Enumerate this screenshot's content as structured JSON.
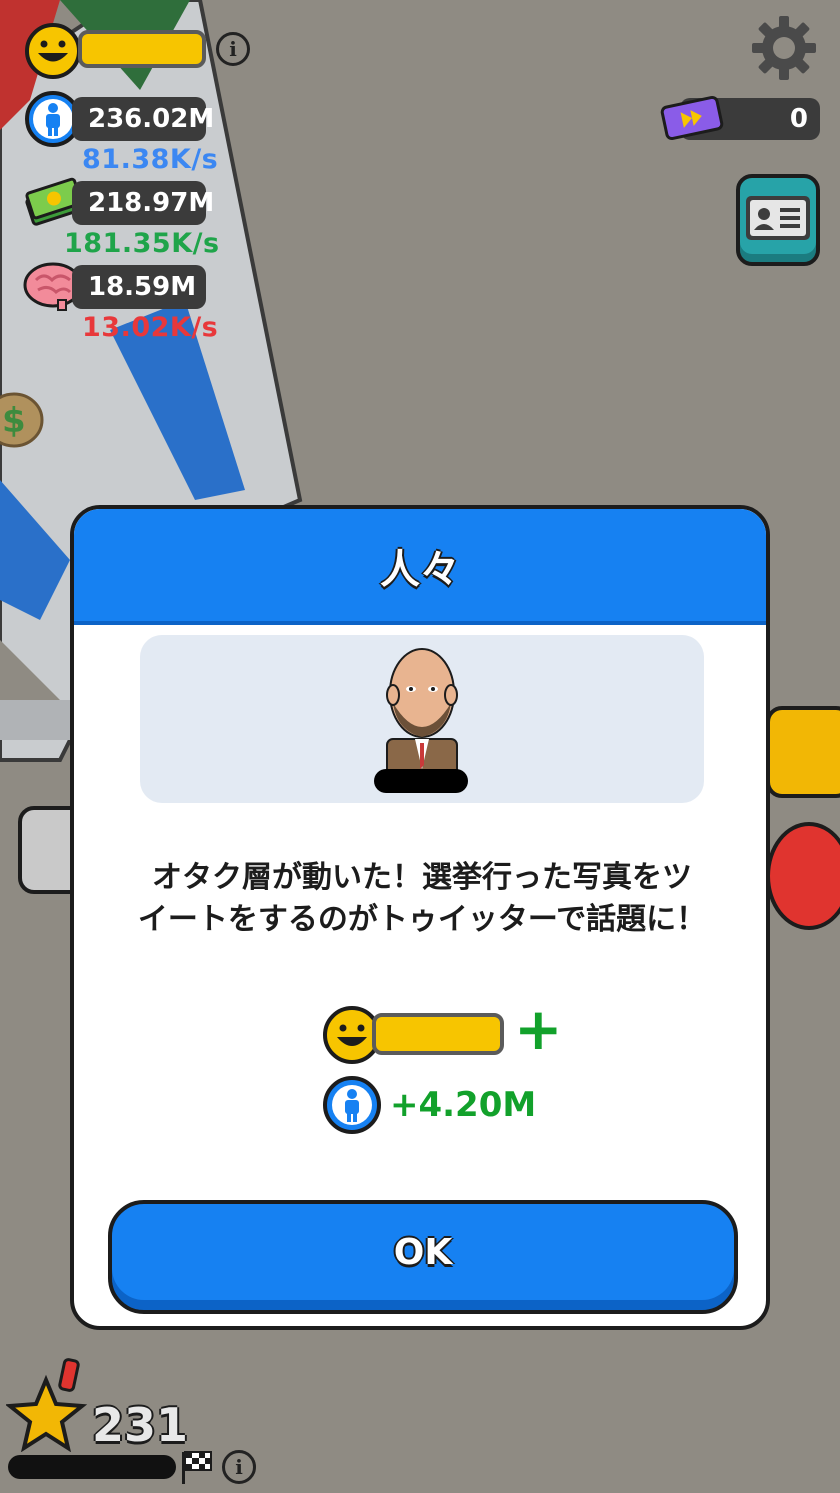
{
  "hud": {
    "people_value": "236.02M",
    "people_rate": "81.38K/s",
    "money_value": "218.97M",
    "money_rate": "181.35K/s",
    "brain_value": "18.59M",
    "brain_rate": "13.02K/s",
    "ticket_count": "0",
    "info_symbol": "i",
    "colors": {
      "people_rate": "#3b87f2",
      "money_rate": "#1fa44a",
      "brain_rate": "#e8383b"
    }
  },
  "modal": {
    "title": "人々",
    "message_line1": "オタク層が動いた！選挙行った写真をツ",
    "message_line2": "イートをするのがトゥイッターで話題に！",
    "reward_plus": "+",
    "reward_people": "+4.20M",
    "ok_label": "OK"
  },
  "footer": {
    "level": "231",
    "info_symbol": "i"
  },
  "icons": [
    "happy-face-icon",
    "person-icon",
    "money-stack-icon",
    "brain-icon",
    "gear-icon",
    "ticket-icon",
    "id-card-icon",
    "star-icon",
    "checkered-flag-icon",
    "info-icon"
  ]
}
